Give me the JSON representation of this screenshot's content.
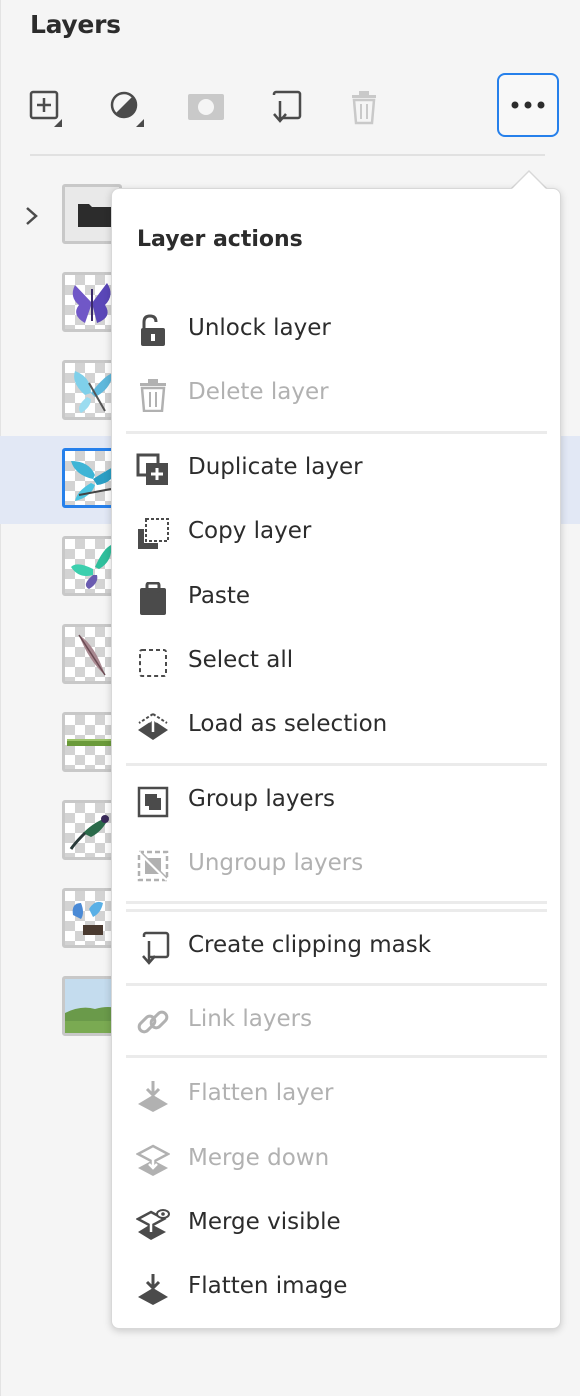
{
  "panel": {
    "title": "Layers"
  },
  "toolbar": [
    {
      "name": "add-layer-button",
      "icon": "add-layer-icon"
    },
    {
      "name": "adjustment-layer-button",
      "icon": "adjustment-layer-icon"
    },
    {
      "name": "add-mask-button",
      "icon": "mask-icon"
    },
    {
      "name": "clipping-mask-button",
      "icon": "clipping-mask-icon"
    },
    {
      "name": "delete-layer-button",
      "icon": "trash-icon"
    },
    {
      "name": "more-options-button",
      "icon": "more-icon"
    }
  ],
  "layers": [
    {
      "type": "group",
      "thumbnail": "folder-icon",
      "expanded": false
    },
    {
      "type": "image",
      "thumbnail": "purple-butterfly"
    },
    {
      "type": "image",
      "thumbnail": "light-blue-butterfly"
    },
    {
      "type": "image",
      "thumbnail": "blue-butterfly",
      "selected": true
    },
    {
      "type": "image",
      "thumbnail": "teal-butterfly"
    },
    {
      "type": "image",
      "thumbnail": "feather"
    },
    {
      "type": "image",
      "thumbnail": "grass-strip"
    },
    {
      "type": "image",
      "thumbnail": "hummingbird"
    },
    {
      "type": "image",
      "thumbnail": "butterflies-on-stump"
    },
    {
      "type": "image",
      "thumbnail": "landscape"
    }
  ],
  "menu": {
    "heading": "Layer actions",
    "items": [
      {
        "label": "Unlock layer",
        "icon": "unlock-icon",
        "enabled": true
      },
      {
        "label": "Delete layer",
        "icon": "trash-icon",
        "enabled": false
      },
      {
        "label": "Duplicate layer",
        "icon": "duplicate-icon",
        "enabled": true
      },
      {
        "label": "Copy layer",
        "icon": "copy-icon",
        "enabled": true
      },
      {
        "label": "Paste",
        "icon": "clipboard-icon",
        "enabled": true
      },
      {
        "label": "Select all",
        "icon": "select-all-icon",
        "enabled": true
      },
      {
        "label": "Load as selection",
        "icon": "load-selection-icon",
        "enabled": true
      },
      {
        "label": "Group layers",
        "icon": "group-icon",
        "enabled": true
      },
      {
        "label": "Ungroup layers",
        "icon": "ungroup-icon",
        "enabled": false
      },
      {
        "label": "Create clipping mask",
        "icon": "clipping-mask-icon",
        "enabled": true
      },
      {
        "label": "Link layers",
        "icon": "link-icon",
        "enabled": false
      },
      {
        "label": "Flatten layer",
        "icon": "flatten-layer-icon",
        "enabled": false
      },
      {
        "label": "Merge down",
        "icon": "merge-down-icon",
        "enabled": false
      },
      {
        "label": "Merge visible",
        "icon": "merge-visible-icon",
        "enabled": true
      },
      {
        "label": "Flatten image",
        "icon": "flatten-image-icon",
        "enabled": true
      }
    ]
  },
  "colors": {
    "accent": "#2680eb",
    "selected_row": "#e2e8f5",
    "panel_bg": "#f5f5f5",
    "disabled_text": "#b1b1b1"
  }
}
